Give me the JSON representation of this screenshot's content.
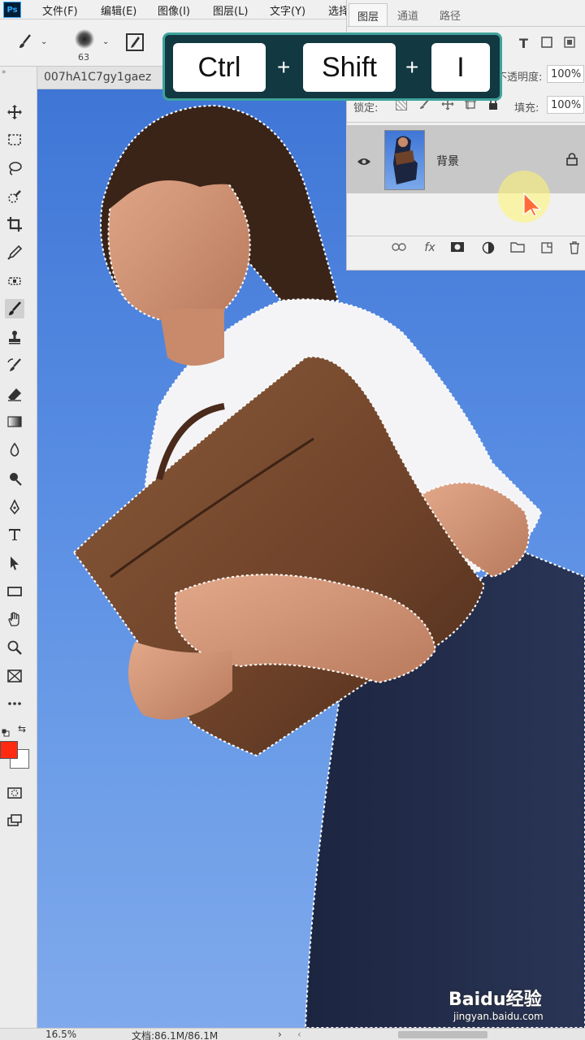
{
  "app": {
    "logo": "Ps"
  },
  "menu": {
    "items": [
      "文件(F)",
      "编辑(E)",
      "图像(I)",
      "图层(L)",
      "文字(Y)",
      "选择"
    ]
  },
  "options": {
    "brush_size": "63"
  },
  "document": {
    "tab_title": "007hA1C7gy1gaez"
  },
  "shortcut": {
    "keys": [
      "Ctrl",
      "Shift",
      "I"
    ],
    "separator": "+"
  },
  "layers_panel": {
    "tabs": [
      "图层",
      "通道",
      "路径"
    ],
    "opacity_label": "不透明度:",
    "opacity_value": "100%",
    "lock_label": "锁定:",
    "fill_label": "填充:",
    "fill_value": "100%",
    "layer_name": "背景"
  },
  "colors": {
    "foreground": "#ff2a0f",
    "background": "#ffffff",
    "sky": "#5b8fe4",
    "overlay_bg": "#123842",
    "overlay_border": "#3fa39b"
  },
  "status": {
    "zoom": "16.5%",
    "doc_size": "文档:86.1M/86.1M"
  },
  "watermark": {
    "brand": "Baidu经验",
    "url": "jingyan.baidu.com"
  }
}
